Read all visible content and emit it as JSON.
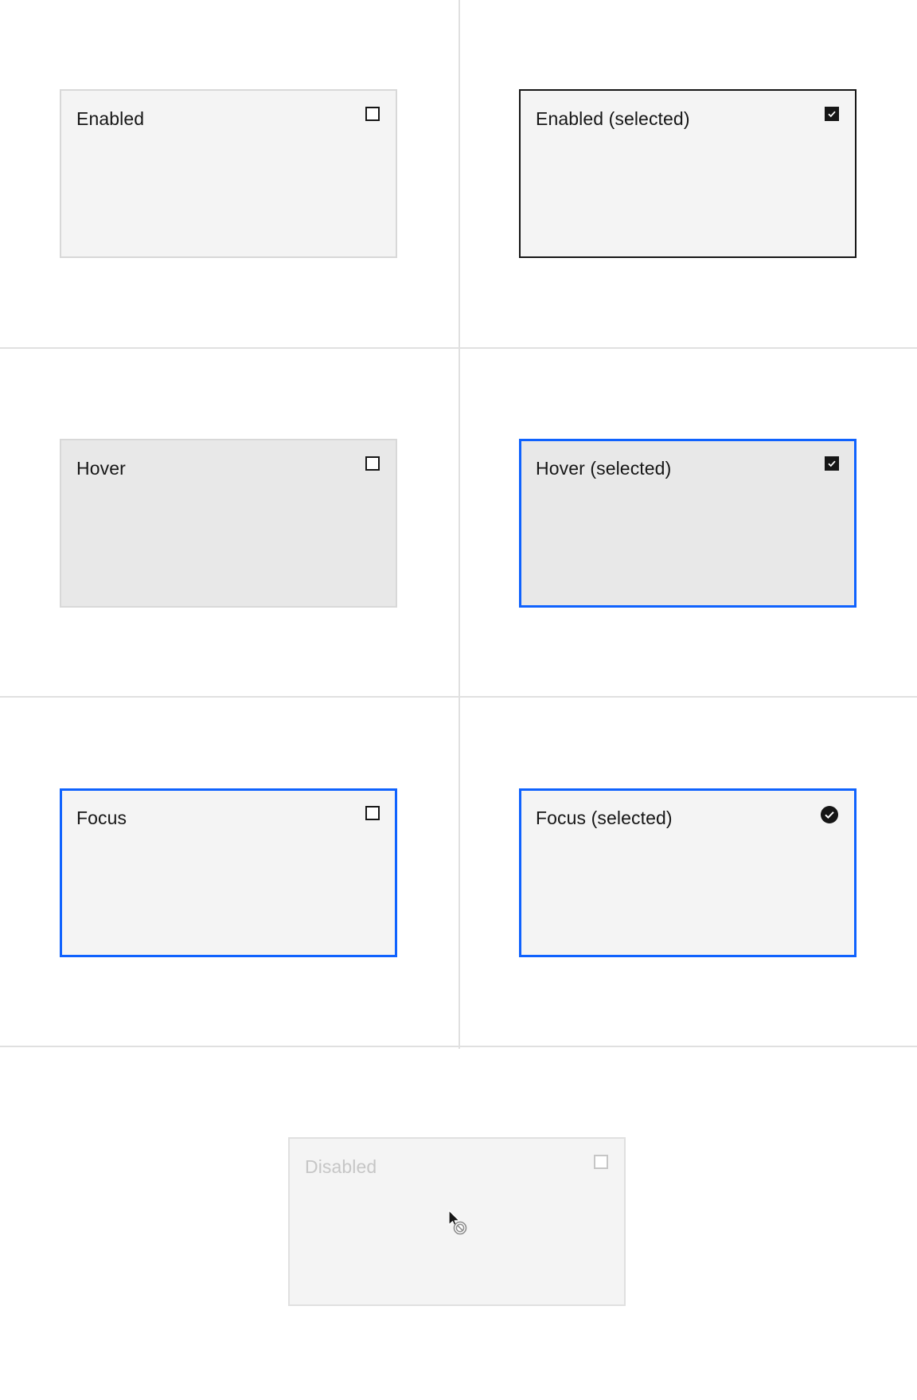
{
  "tiles": {
    "enabled": {
      "label": "Enabled",
      "selected": false
    },
    "enabled_selected": {
      "label": "Enabled (selected)",
      "selected": true
    },
    "hover": {
      "label": "Hover",
      "selected": false
    },
    "hover_selected": {
      "label": "Hover (selected)",
      "selected": true
    },
    "focus": {
      "label": "Focus",
      "selected": false
    },
    "focus_selected": {
      "label": "Focus (selected)",
      "selected": true
    },
    "disabled": {
      "label": "Disabled",
      "selected": false
    }
  },
  "colors": {
    "background": "#ffffff",
    "tile_bg": "#f4f4f4",
    "tile_hover_bg": "#e8e8e8",
    "selected_border": "#161616",
    "focus_border": "#0f62fe",
    "disabled_text": "#c6c6c6",
    "grid_line": "#e0e0e0"
  },
  "icons": {
    "unchecked": "checkbox-icon",
    "checked": "checkbox-checked-icon",
    "focus_selected": "checkmark-filled-icon",
    "cursor": "not-allowed-cursor-icon"
  }
}
